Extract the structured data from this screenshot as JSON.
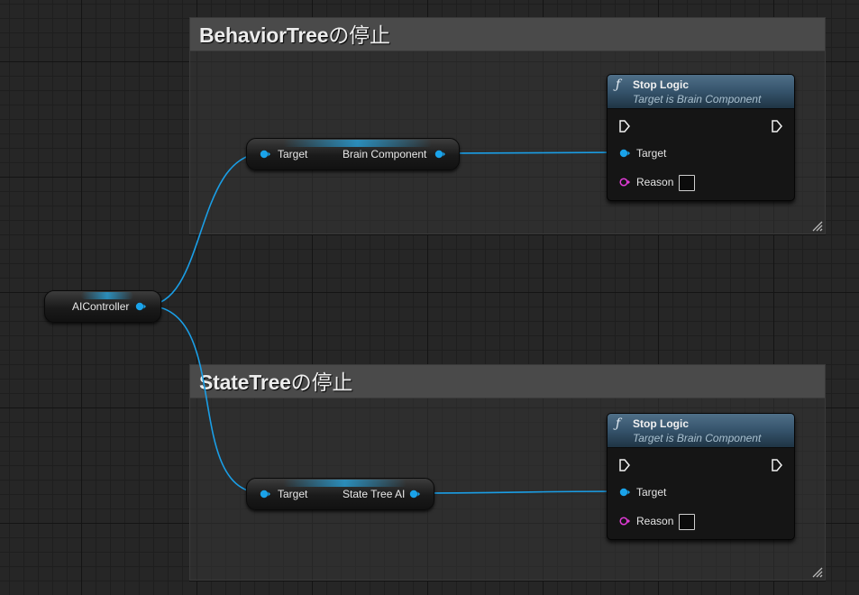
{
  "comments": [
    {
      "id": "behavior",
      "title_main": "BehaviorTree",
      "title_suffix": "の停止"
    },
    {
      "id": "state",
      "title_main": "StateTree",
      "title_suffix": "の停止"
    }
  ],
  "nodes": {
    "ai_controller": {
      "label": "AIController"
    },
    "brain_getter": {
      "input_label": "Target",
      "output_label": "Brain Component"
    },
    "state_getter": {
      "input_label": "Target",
      "output_label": "State Tree AI"
    },
    "stop_logic_1": {
      "title": "Stop Logic",
      "subtitle": "Target is Brain Component",
      "target_label": "Target",
      "reason_label": "Reason"
    },
    "stop_logic_2": {
      "title": "Stop Logic",
      "subtitle": "Target is Brain Component",
      "target_label": "Target",
      "reason_label": "Reason"
    }
  },
  "icons": {
    "function": "function-f-icon",
    "exec_in": "exec-arrow-icon",
    "exec_out": "exec-arrow-icon",
    "object_pin": "object-pin-icon",
    "string_pin": "string-pin-icon"
  },
  "colors": {
    "object_pin": "#1aa3ea",
    "string_pin": "#e13bd7",
    "wire": "#1a9ee6",
    "func_header": "#3d5a70"
  }
}
